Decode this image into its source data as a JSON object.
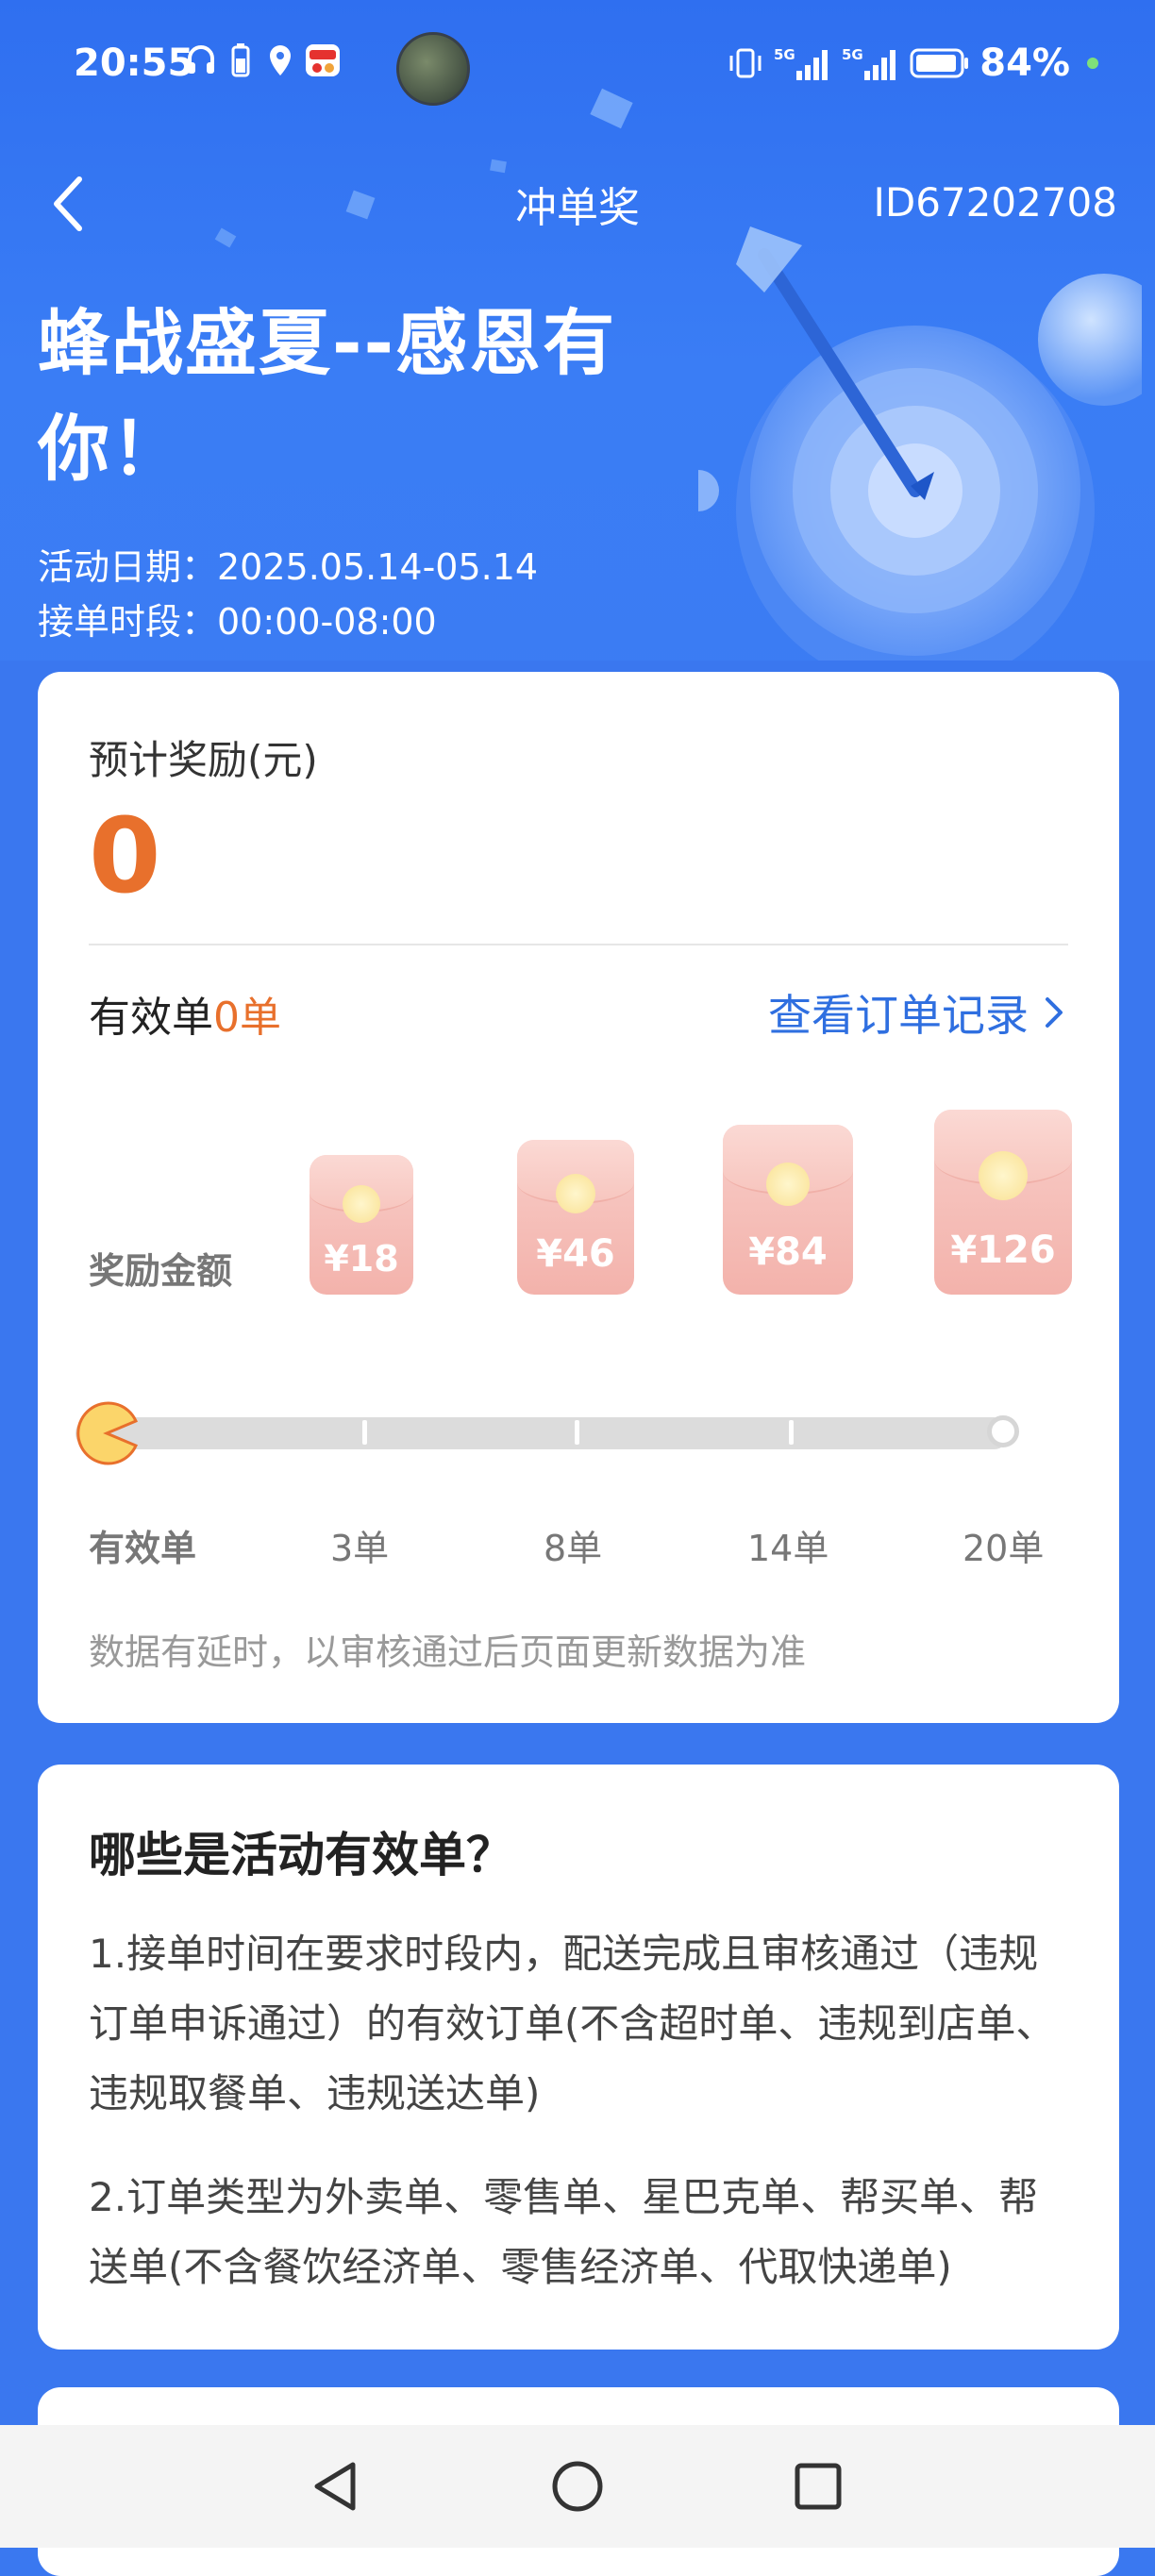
{
  "status_bar": {
    "time": "20:55",
    "battery_text": "84%",
    "network_labels": [
      "5G",
      "5G"
    ],
    "icons": [
      "headphones-icon",
      "battery-saver-icon",
      "location-icon",
      "app-notification-icon",
      "vibrate-icon",
      "signal-icon",
      "battery-icon"
    ]
  },
  "nav": {
    "title": "冲单奖",
    "user_id": "ID67202708"
  },
  "hero": {
    "title": "蜂战盛夏--感恩有你！",
    "date": "活动日期：2025.05.14-05.14",
    "order_period": "接单时段：00:00-08:00"
  },
  "reward_card": {
    "estimated_label": "预计奖励(元)",
    "estimated_value": "0",
    "valid_prefix": "有效单",
    "valid_count": "0单",
    "records_link": "查看订单记录",
    "reward_label": "奖励金额",
    "tiers": [
      {
        "amount": "¥18",
        "orders": "3单"
      },
      {
        "amount": "¥46",
        "orders": "8单"
      },
      {
        "amount": "¥84",
        "orders": "14单"
      },
      {
        "amount": "¥126",
        "orders": "20单"
      }
    ],
    "progress_label": "有效单",
    "progress_fraction": 0,
    "note": "数据有延时，以审核通过后页面更新数据为准"
  },
  "rules_card": {
    "title": "哪些是活动有效单？",
    "rules": [
      "1.接单时间在要求时段内，配送完成且审核通过（违规订单申诉通过）的有效订单(不含超时单、违规到店单、违规取餐单、违规送达单)",
      "2.订单类型为外卖单、零售单、星巴克单、帮买单、帮送单(不含餐饮经济单、零售经济单、代取快递单)"
    ]
  },
  "colors": {
    "primary_blue": "#3a77ef",
    "accent_orange": "#e8702c",
    "link_blue": "#2f6fe0"
  }
}
